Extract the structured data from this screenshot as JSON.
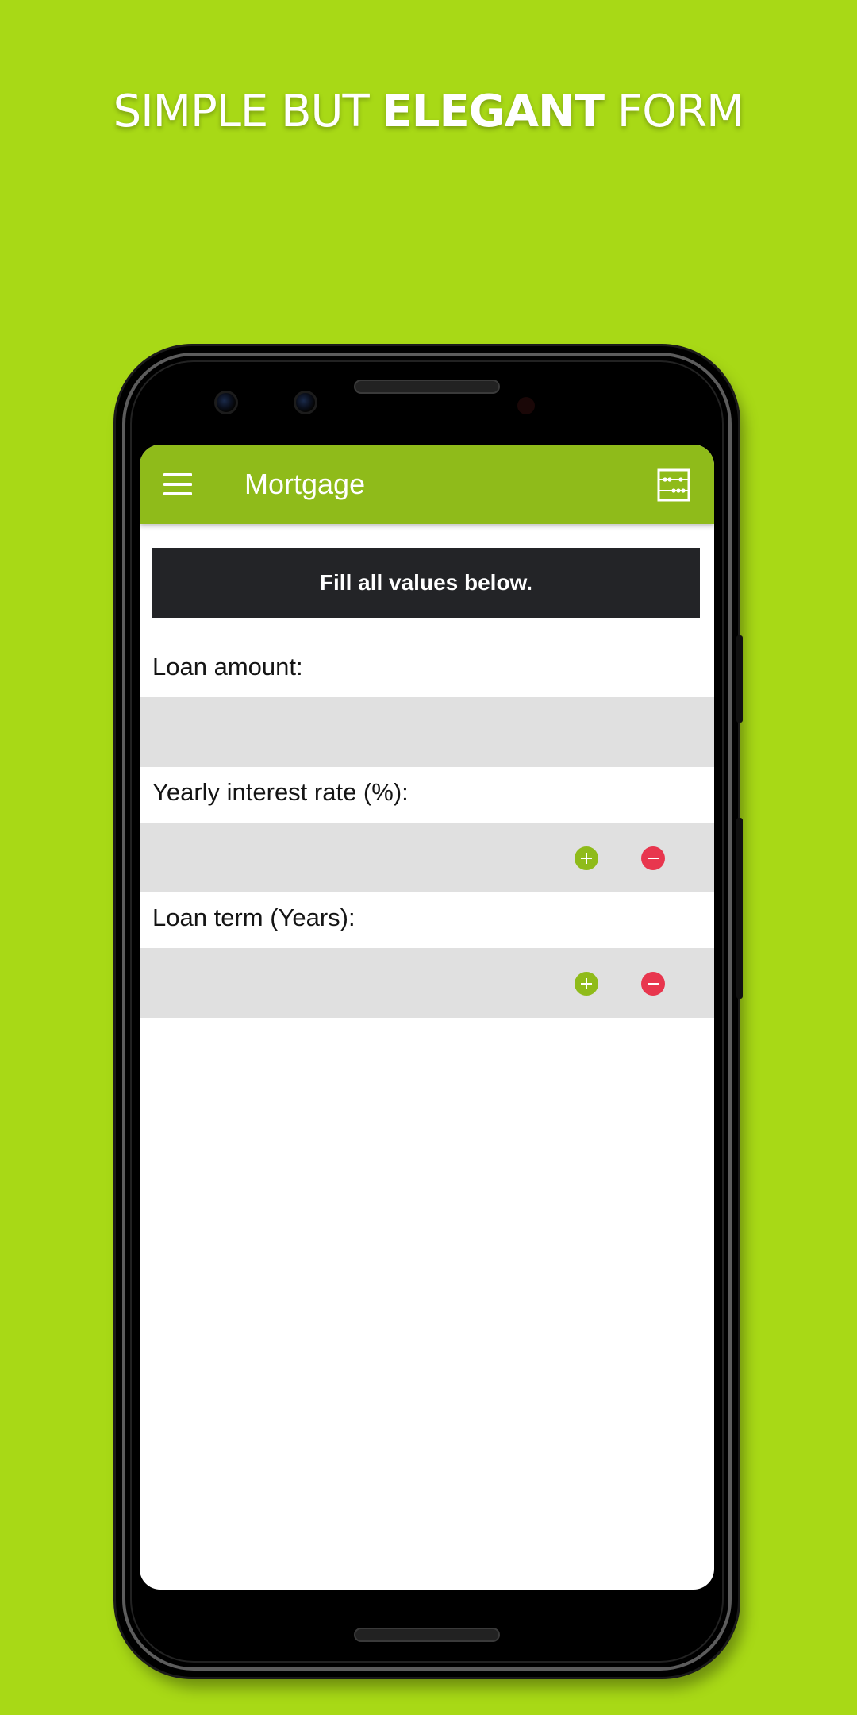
{
  "banner": {
    "text_normal_1": "SIMPLE BUT ",
    "text_bold": "ELEGANT",
    "text_normal_2": " FORM"
  },
  "colors": {
    "background": "#a8d916",
    "app_bar": "#8fbb1a",
    "notice_background": "#232427",
    "field_background": "#e0e0e0",
    "increment": "#8fbb1a",
    "decrement": "#e8364e"
  },
  "app_bar": {
    "title": "Mortgage",
    "menu_icon": "hamburger-menu-icon",
    "action_icon": "abacus-icon"
  },
  "notice": {
    "text": "Fill all values below."
  },
  "fields": {
    "loan_amount": {
      "label": "Loan amount:",
      "value": ""
    },
    "interest_rate": {
      "label": "Yearly interest rate (%):",
      "value": "",
      "increment_icon": "plus-icon",
      "decrement_icon": "minus-icon"
    },
    "loan_term": {
      "label": "Loan term (Years):",
      "value": "",
      "increment_icon": "plus-icon",
      "decrement_icon": "minus-icon"
    }
  }
}
